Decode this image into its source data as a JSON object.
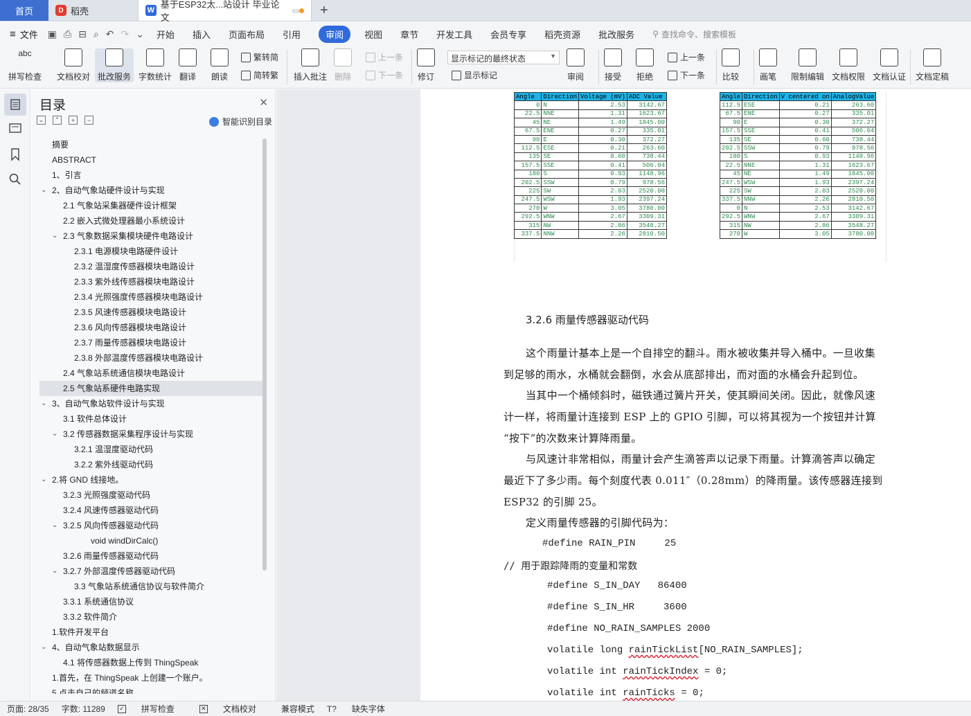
{
  "tabs": {
    "home": "首页",
    "tab1": "稻壳",
    "tab2": "基于ESP32太...站设计 毕业论文"
  },
  "menu": {
    "file": "文件",
    "items": [
      "开始",
      "插入",
      "页面布局",
      "引用"
    ],
    "active": "审阅",
    "items2": [
      "视图",
      "章节",
      "开发工具",
      "会员专享",
      "稻壳资源",
      "批改服务"
    ],
    "search": "查找命令、搜索模板"
  },
  "ribbon": {
    "spell": "拼写检查",
    "proof": "文档校对",
    "review_service": "批改服务",
    "wordcount": "字数统计",
    "translate": "翻译",
    "read_aloud": "朗读",
    "trad": "繁转简",
    "simp": "简转繁",
    "insert_comment": "插入批注",
    "delete": "删除",
    "prev": "上一条",
    "next": "下一条",
    "track": "修订",
    "markup_state": "显示标记的最终状态",
    "show_markup": "显示标记",
    "review_pane": "审阅",
    "accept": "接受",
    "reject": "拒绝",
    "prev2": "上一条",
    "next2": "下一条",
    "compare": "比较",
    "pen": "画笔",
    "restrict": "限制编辑",
    "doc_rights": "文档权限",
    "doc_cert": "文档认证",
    "doc_final": "文档定稿"
  },
  "toc": {
    "title": "目录",
    "smart": "智能识别目录",
    "items": [
      {
        "text": "摘要"
      },
      {
        "text": "ABSTRACT"
      },
      {
        "text": "1、引言"
      },
      {
        "text": "2、自动气象站硬件设计与实现"
      },
      {
        "text": "2.1 气象站采集器硬件设计框架"
      },
      {
        "text": "2.2 嵌入式微处理器最小系统设计"
      },
      {
        "text": "2.3  气象数据采集模块硬件电路设计"
      },
      {
        "text": "2.3.1 电源模块电路硬件设计"
      },
      {
        "text": "2.3.2 温湿度传感器模块电路设计"
      },
      {
        "text": "2.3.3 紫外线传感器模块电路设计"
      },
      {
        "text": "2.3.4 光照强度传感器模块电路设计"
      },
      {
        "text": "2.3.5 风速传感器模块电路设计"
      },
      {
        "text": "2.3.6 风向传感器模块电路设计"
      },
      {
        "text": "2.3.7 雨量传感器模块电路设计"
      },
      {
        "text": "2.3.8 外部温度传感器模块电路设计"
      },
      {
        "text": "2.4 气象站系统通信模块电路设计"
      },
      {
        "text": "2.5 气象站系硬件电路实现"
      },
      {
        "text": "3、自动气象站软件设计与实现"
      },
      {
        "text": "3.1 软件总体设计"
      },
      {
        "text": "3.2 传感器数据采集程序设计与实现"
      },
      {
        "text": "3.2.1 温湿度驱动代码"
      },
      {
        "text": "3.2.2 紫外线驱动代码"
      },
      {
        "text": "2.将 GND 线接地。"
      },
      {
        "text": "3.2.3 光照强度驱动代码"
      },
      {
        "text": "3.2.4 风速传感器驱动代码"
      },
      {
        "text": "3.2.5 风向传感器驱动代码"
      },
      {
        "text": "void windDirCalc()"
      },
      {
        "text": "3.2.6 雨量传感器驱动代码"
      },
      {
        "text": "3.2.7 外部温度传感器驱动代码"
      },
      {
        "text": "3.3 气象站系统通信协议与软件简介"
      },
      {
        "text": "3.3.1 系统通信协议"
      },
      {
        "text": "3.3.2 软件简介"
      },
      {
        "text": "1.软件开发平台"
      },
      {
        "text": "4、自动气象站数据显示"
      },
      {
        "text": "4.1 将传感器数据上传到 ThingSpeak"
      },
      {
        "text": "1.首先，在 ThingSpeak 上创建一个账户。"
      },
      {
        "text": "5.点击自己的频道名称。"
      }
    ]
  },
  "table1": {
    "headers": [
      "Angle",
      "Direction",
      "Voltage (mV)",
      "ADC Value"
    ],
    "rows": [
      [
        "0",
        "N",
        "2.53",
        "3142.67"
      ],
      [
        "22.5",
        "NNE",
        "1.31",
        "1623.67"
      ],
      [
        "45",
        "NE",
        "1.49",
        "1845.00"
      ],
      [
        "67.5",
        "ENE",
        "0.27",
        "335.01"
      ],
      [
        "90",
        "E",
        "0.30",
        "372.27"
      ],
      [
        "112.5",
        "ESE",
        "0.21",
        "263.60"
      ],
      [
        "135",
        "SE",
        "0.60",
        "738.44"
      ],
      [
        "157.5",
        "SSE",
        "0.41",
        "506.04"
      ],
      [
        "180",
        "S",
        "0.93",
        "1148.96"
      ],
      [
        "202.5",
        "SSW",
        "0.79",
        "978.56"
      ],
      [
        "225",
        "SW",
        "2.03",
        "2520.00"
      ],
      [
        "247.5",
        "WSW",
        "1.93",
        "2397.24"
      ],
      [
        "270",
        "W",
        "3.05",
        "3780.00"
      ],
      [
        "292.5",
        "WNW",
        "2.67",
        "3309.31"
      ],
      [
        "315",
        "NW",
        "2.86",
        "3548.27"
      ],
      [
        "337.5",
        "NNW",
        "2.26",
        "2810.50"
      ]
    ]
  },
  "table2": {
    "headers": [
      "Angle",
      "Direction",
      "V centered on",
      "AnalogValue"
    ],
    "rows": [
      [
        "112.5",
        "ESE",
        "0.21",
        "263.60"
      ],
      [
        "67.5",
        "ENE",
        "0.27",
        "335.01"
      ],
      [
        "90",
        "E",
        "0.30",
        "372.27"
      ],
      [
        "157.5",
        "SSE",
        "0.41",
        "506.04"
      ],
      [
        "135",
        "SE",
        "0.60",
        "738.44"
      ],
      [
        "202.5",
        "SSW",
        "0.79",
        "978.56"
      ],
      [
        "180",
        "S",
        "0.93",
        "1148.96"
      ],
      [
        "22.5",
        "NNE",
        "1.31",
        "1623.67"
      ],
      [
        "45",
        "NE",
        "1.49",
        "1845.00"
      ],
      [
        "247.5",
        "WSW",
        "1.93",
        "2397.24"
      ],
      [
        "225",
        "SW",
        "2.03",
        "2520.00"
      ],
      [
        "337.5",
        "NNW",
        "2.26",
        "2810.50"
      ],
      [
        "0",
        "N",
        "2.53",
        "3142.67"
      ],
      [
        "292.5",
        "WNW",
        "2.67",
        "3309.31"
      ],
      [
        "315",
        "NW",
        "2.86",
        "3548.27"
      ],
      [
        "270",
        "W",
        "3.05",
        "3780.00"
      ]
    ]
  },
  "doc": {
    "heading": "3.2.6 雨量传感器驱动代码",
    "p1_line1": "这个雨量计基本上是一个自排空的翻斗。雨水被收集并导入桶中。一旦收集",
    "p1_line2": "到足够的雨水，水桶就会翻倒，水会从底部排出，而对面的水桶会升起到位。",
    "p2_line1": "当其中一个桶倾斜时，磁铁通过簧片开关，使其瞬间关闭。因此，就像风速",
    "p2_line2": "计一样，将雨量计连接到 ESP 上的 GPIO 引脚，可以将其视为一个按钮并计算",
    "p2_line3": "“按下”的次数来计算降雨量。",
    "p3_line1": "与风速计非常相似，雨量计会产生滴答声以记录下雨量。计算滴答声以确定",
    "p3_line2": "最近下了多少雨。每个刻度代表 0.011″（0.28mm）的降雨量。该传感器连接到",
    "p3_line3": "ESP32 的引脚 25。",
    "p4": "定义雨量传感器的引脚代码为：",
    "code1": "#define RAIN_PIN     25",
    "comment": "// 用于跟踪降雨的变量和常数",
    "code2": "#define S_IN_DAY   86400",
    "code3": "#define S_IN_HR     3600",
    "code4": "#define NO_RAIN_SAMPLES 2000",
    "code5_a": "volatile long ",
    "code5_b": "rainTickList",
    "code5_c": "[NO_RAIN_SAMPLES];",
    "code6_a": "volatile int ",
    "code6_b": "rainTickIndex",
    "code6_c": " = 0;",
    "code7_a": "volatile int ",
    "code7_b": "rainTicks",
    "code7_c": " = 0;"
  },
  "status": {
    "page": "页面: 28/35",
    "words": "字数: 11289",
    "spell": "拼写检查",
    "proof": "文档校对",
    "compat": "兼容模式",
    "font": "缺失字体"
  }
}
